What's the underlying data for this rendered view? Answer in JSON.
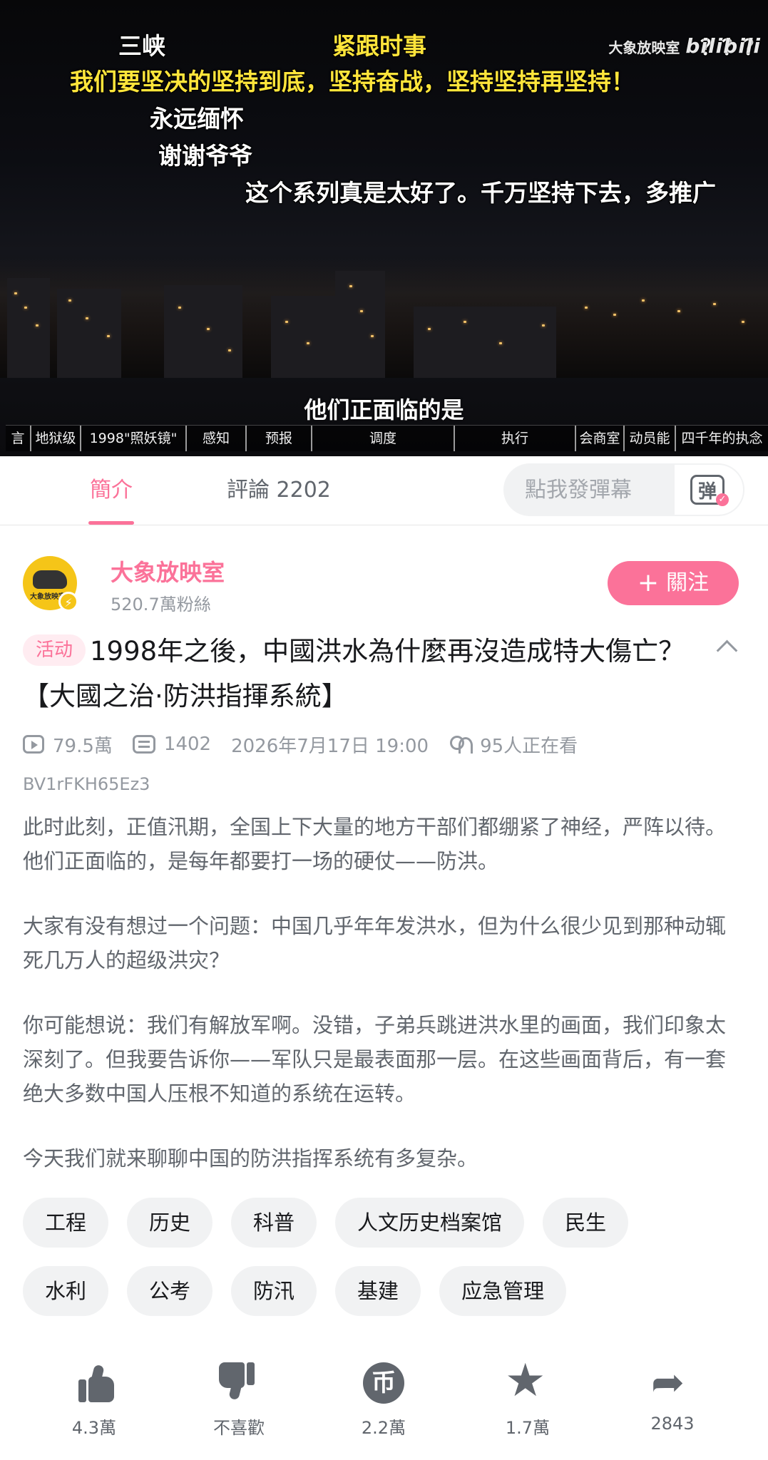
{
  "video": {
    "danmaku": [
      {
        "text": "三峡",
        "color": "white"
      },
      {
        "text": "紧跟时事",
        "color": "yellow"
      },
      {
        "text": "我们要坚决的坚持到底，坚持奋战，坚持坚持再坚持！",
        "color": "yellow"
      },
      {
        "text": "永远缅怀",
        "color": "white"
      },
      {
        "text": "谢谢爷爷",
        "color": "white"
      },
      {
        "text": "这个系列真是太好了。千万坚持下去，多推广",
        "color": "white"
      },
      {
        "text": "？？？",
        "color": "white"
      }
    ],
    "watermark": "大象放映室",
    "watermark_logo": "bilibili",
    "subtitle": "他们正面临的是",
    "chapters": [
      "言",
      "地狱级",
      "1998\"照妖镜\"",
      "感知",
      "预报",
      "调度",
      "执行",
      "会商室",
      "动员能",
      "四千年的执念"
    ]
  },
  "tabs": {
    "intro": "簡介",
    "comments": "評論 2202"
  },
  "danmu_input": {
    "placeholder": "點我發彈幕",
    "toggle_glyph": "弹"
  },
  "uploader": {
    "name": "大象放映室",
    "fans": "520.7萬粉絲",
    "avatar_text": "大象放映室",
    "follow_label": "關注",
    "follow_plus": "+"
  },
  "title": {
    "badge": "活动",
    "text": "1998年之後，中國洪水為什麼再沒造成特大傷亡？【大國之治·防洪指揮系統】"
  },
  "stats": {
    "views": "79.5萬",
    "danmaku": "1402",
    "date": "2026年7月17日 19:00",
    "watching": "95人正在看"
  },
  "bvid": "BV1rFKH65Ez3",
  "description": [
    "此时此刻，正值汛期，全国上下大量的地方干部们都绷紧了神经，严阵以待。他们正面临的，是每年都要打一场的硬仗——防洪。",
    "大家有没有想过一个问题：中国几乎年年发洪水，但为什么很少见到那种动辄死几万人的超级洪灾？",
    "你可能想说：我们有解放军啊。没错，子弟兵跳进洪水里的画面，我们印象太深刻了。但我要告诉你——军队只是最表面那一层。在这些画面背后，有一套绝大多数中国人压根不知道的系统在运转。",
    "今天我们就来聊聊中国的防洪指挥系统有多复杂。"
  ],
  "tags": {
    "row1": [
      "工程",
      "历史",
      "科普",
      "人文历史档案馆",
      "民生"
    ],
    "row2": [
      "水利",
      "公考",
      "防汛",
      "基建",
      "应急管理"
    ]
  },
  "actions": {
    "like": "4.3萬",
    "dislike": "不喜歡",
    "coin": "2.2萬",
    "coin_glyph": "币",
    "favorite": "1.7萬",
    "share": "2843"
  },
  "colors": {
    "accent": "#fb7299",
    "danmaku_yellow": "#ffe53b",
    "text_secondary": "#61666d",
    "text_muted": "#9499a0"
  }
}
